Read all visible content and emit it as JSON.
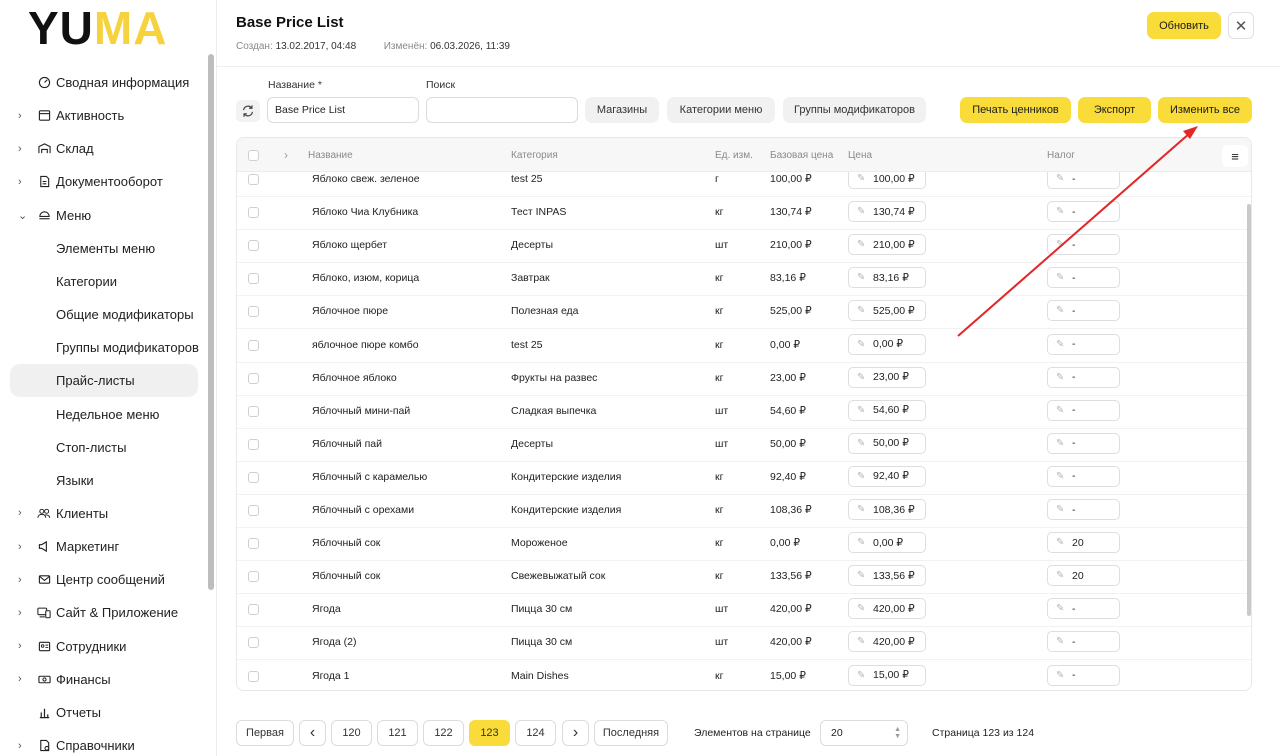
{
  "logo": {
    "part1": "YU",
    "part2": "MA"
  },
  "sidebar": {
    "items": [
      {
        "label": "Сводная информация",
        "icon": "dashboard-icon",
        "expandable": false,
        "sub": false
      },
      {
        "label": "Активность",
        "icon": "activity-icon",
        "expandable": true,
        "sub": false
      },
      {
        "label": "Склад",
        "icon": "warehouse-icon",
        "expandable": true,
        "sub": false
      },
      {
        "label": "Документооборот",
        "icon": "document-icon",
        "expandable": true,
        "sub": false
      },
      {
        "label": "Меню",
        "icon": "menu-book-icon",
        "expandable": true,
        "expanded": true,
        "sub": false
      },
      {
        "label": "Элементы меню",
        "sub": true
      },
      {
        "label": "Категории",
        "sub": true
      },
      {
        "label": "Общие модификаторы",
        "sub": true
      },
      {
        "label": "Группы модификаторов",
        "sub": true
      },
      {
        "label": "Прайс-листы",
        "sub": true,
        "active": true
      },
      {
        "label": "Недельное меню",
        "sub": true
      },
      {
        "label": "Стоп-листы",
        "sub": true
      },
      {
        "label": "Языки",
        "sub": true
      },
      {
        "label": "Клиенты",
        "icon": "clients-icon",
        "expandable": true,
        "sub": false
      },
      {
        "label": "Маркетинг",
        "icon": "marketing-icon",
        "expandable": true,
        "sub": false
      },
      {
        "label": "Центр сообщений",
        "icon": "mail-icon",
        "expandable": true,
        "sub": false
      },
      {
        "label": "Сайт & Приложение",
        "icon": "devices-icon",
        "expandable": true,
        "sub": false
      },
      {
        "label": "Сотрудники",
        "icon": "id-card-icon",
        "expandable": true,
        "sub": false
      },
      {
        "label": "Финансы",
        "icon": "money-icon",
        "expandable": true,
        "sub": false
      },
      {
        "label": "Отчеты",
        "icon": "bar-chart-icon",
        "expandable": false,
        "sub": false
      },
      {
        "label": "Справочники",
        "icon": "reference-icon",
        "expandable": true,
        "sub": false
      }
    ]
  },
  "header": {
    "title": "Base Price List",
    "created_label": "Создан:",
    "created_value": "13.02.2017, 04:48",
    "modified_label": "Изменён:",
    "modified_value": "06.03.2026, 11:39",
    "refresh_label": "Обновить",
    "close_symbol": "✕"
  },
  "filters": {
    "name_label": "Название *",
    "name_value": "Base Price List",
    "search_label": "Поиск",
    "search_value": "",
    "stores_label": "Магазины",
    "menu_categories_label": "Категории меню",
    "modifier_groups_label": "Группы модификаторов",
    "print_tags_label": "Печать ценников",
    "export_label": "Экспорт",
    "change_all_label": "Изменить все"
  },
  "table": {
    "columns": {
      "name": "Название",
      "category": "Категория",
      "unit": "Ед. изм.",
      "base_price": "Базовая цена",
      "price": "Цена",
      "tax": "Налог"
    },
    "rows": [
      {
        "name": "Яблоко свеж. зеленое",
        "category": "test 25",
        "unit": "г",
        "base_price": "100,00 ₽",
        "price": "100,00 ₽",
        "tax": "-"
      },
      {
        "name": "Яблоко Чиа Клубника",
        "category": "Тест INPAS",
        "unit": "кг",
        "base_price": "130,74 ₽",
        "price": "130,74 ₽",
        "tax": "-"
      },
      {
        "name": "Яблоко щербет",
        "category": "Десерты",
        "unit": "шт",
        "base_price": "210,00 ₽",
        "price": "210,00 ₽",
        "tax": "-"
      },
      {
        "name": "Яблоко, изюм, корица",
        "category": "Завтрак",
        "unit": "кг",
        "base_price": "83,16 ₽",
        "price": "83,16 ₽",
        "tax": "-"
      },
      {
        "name": "Яблочное пюре",
        "category": "Полезная еда",
        "unit": "кг",
        "base_price": "525,00 ₽",
        "price": "525,00 ₽",
        "tax": "-"
      },
      {
        "name": "яблочное пюре комбо",
        "category": "test 25",
        "unit": "кг",
        "base_price": "0,00 ₽",
        "price": "0,00 ₽",
        "tax": "-"
      },
      {
        "name": "Яблочное яблоко",
        "category": "Фрукты на развес",
        "unit": "кг",
        "base_price": "23,00 ₽",
        "price": "23,00 ₽",
        "tax": "-"
      },
      {
        "name": "Яблочный мини-пай",
        "category": "Сладкая выпечка",
        "unit": "шт",
        "base_price": "54,60 ₽",
        "price": "54,60 ₽",
        "tax": "-"
      },
      {
        "name": "Яблочный пай",
        "category": "Десерты",
        "unit": "шт",
        "base_price": "50,00 ₽",
        "price": "50,00 ₽",
        "tax": "-"
      },
      {
        "name": "Яблочный с карамелью",
        "category": "Кондитерские изделия",
        "unit": "кг",
        "base_price": "92,40 ₽",
        "price": "92,40 ₽",
        "tax": "-"
      },
      {
        "name": "Яблочный с орехами",
        "category": "Кондитерские изделия",
        "unit": "кг",
        "base_price": "108,36 ₽",
        "price": "108,36 ₽",
        "tax": "-"
      },
      {
        "name": "Яблочный сок",
        "category": "Мороженое",
        "unit": "кг",
        "base_price": "0,00 ₽",
        "price": "0,00 ₽",
        "tax": "20"
      },
      {
        "name": "Яблочный сок",
        "category": "Свежевыжатый сок",
        "unit": "кг",
        "base_price": "133,56 ₽",
        "price": "133,56 ₽",
        "tax": "20"
      },
      {
        "name": "Ягода",
        "category": "Пицца 30 см",
        "unit": "шт",
        "base_price": "420,00 ₽",
        "price": "420,00 ₽",
        "tax": "-"
      },
      {
        "name": "Ягода (2)",
        "category": "Пицца 30 см",
        "unit": "шт",
        "base_price": "420,00 ₽",
        "price": "420,00 ₽",
        "tax": "-"
      },
      {
        "name": "Ягода 1",
        "category": "Main Dishes",
        "unit": "кг",
        "base_price": "15,00 ₽",
        "price": "15,00 ₽",
        "tax": "-"
      }
    ]
  },
  "pagination": {
    "first_label": "Первая",
    "prev_symbol": "‹",
    "pages": [
      "120",
      "121",
      "122",
      "123",
      "124"
    ],
    "current_page": "123",
    "next_symbol": "›",
    "last_label": "Последняя",
    "per_page_label": "Элементов на странице",
    "per_page_value": "20",
    "page_info": "Страница 123 из 124"
  },
  "colors": {
    "accent": "#f9db3a",
    "annotation_arrow": "#e32626"
  }
}
